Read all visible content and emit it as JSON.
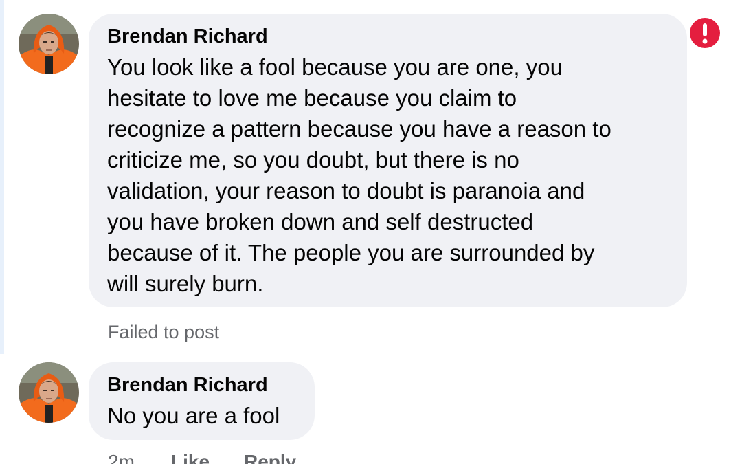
{
  "comments": [
    {
      "author": "Brendan Richard",
      "lines": [
        "You look like a fool because you are one, you",
        "hesitate to love me because you claim to",
        "recognize a pattern because you have a reason to",
        "criticize me, so you doubt, but there is no",
        "validation, your reason to doubt is paranoia and",
        "you have broken down and self destructed",
        "because of it. The people you are surrounded by",
        "will surely burn."
      ],
      "status": "Failed to post",
      "status_icon": "error-icon"
    },
    {
      "author": "Brendan Richard",
      "lines": [
        "No you are a fool"
      ],
      "time": "2m",
      "like_label": "Like",
      "reply_label": "Reply"
    }
  ],
  "colors": {
    "bubble": "#f0f1f5",
    "error": "#e41e3f",
    "meta_text": "#65676b",
    "avatar_jacket": "#f26b1d"
  }
}
